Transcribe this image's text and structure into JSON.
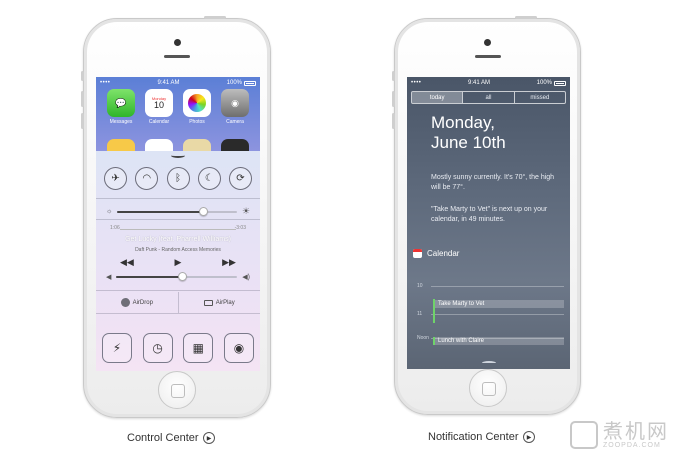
{
  "colors": {
    "page_bg": "#ffffff",
    "phone_body": "#f4f4f4",
    "nc_bg": "#5e6a7c",
    "cc_bg": "#e4e4f4",
    "now_green": "#6fd36a"
  },
  "left_phone": {
    "status": {
      "carrier": "•••• ",
      "time": "9:41 AM",
      "battery": "100%"
    },
    "apps": [
      {
        "label": "Messages",
        "icon": "messages-icon"
      },
      {
        "label": "Calendar",
        "icon": "calendar-icon",
        "day": "10"
      },
      {
        "label": "Photos",
        "icon": "photos-icon"
      },
      {
        "label": "Camera",
        "icon": "camera-icon"
      }
    ],
    "control_center": {
      "toggles": [
        {
          "name": "airplane-mode-toggle",
          "icon": "airplane-icon",
          "glyph": "✈"
        },
        {
          "name": "wifi-toggle",
          "icon": "wifi-icon",
          "glyph": "◠"
        },
        {
          "name": "bluetooth-toggle",
          "icon": "bluetooth-icon",
          "glyph": "ᛒ"
        },
        {
          "name": "do-not-disturb-toggle",
          "icon": "moon-icon",
          "glyph": "☾"
        },
        {
          "name": "rotation-lock-toggle",
          "icon": "rotation-lock-icon",
          "glyph": "⟳"
        }
      ],
      "brightness": 0.72,
      "elapsed": "1:06",
      "remaining": "-3:03",
      "song": "Get Lucky (feat. Pharrell Williams)",
      "artist": "Daft Punk - Random Access Memories",
      "volume": 0.55,
      "airdrop_label": "AirDrop",
      "airplay_label": "AirPlay",
      "quick_actions": [
        {
          "name": "flashlight-button",
          "icon": "flashlight-icon",
          "glyph": "⚡"
        },
        {
          "name": "timer-button",
          "icon": "clock-icon",
          "glyph": "◷"
        },
        {
          "name": "calculator-button",
          "icon": "calculator-icon",
          "glyph": "▦"
        },
        {
          "name": "camera-button",
          "icon": "camera-icon",
          "glyph": "◉"
        }
      ]
    },
    "caption": "Control Center"
  },
  "right_phone": {
    "status": {
      "carrier": "•••• ",
      "time": "9:41 AM",
      "battery": "100%"
    },
    "tabs": [
      {
        "label": "today",
        "active": true
      },
      {
        "label": "all",
        "active": false
      },
      {
        "label": "missed",
        "active": false
      }
    ],
    "date": "Monday,\nJune 10th",
    "weather": "Mostly sunny currently. It's 70°, the high will be 77°.",
    "reminder": "\"Take Marty to Vet\" is next up on your calendar, in 49 minutes.",
    "calendar_title": "Calendar",
    "hours": [
      "10",
      "11",
      "Noon"
    ],
    "events": [
      "Take Marty to Vet",
      "Lunch with Claire"
    ],
    "caption": "Notification Center"
  },
  "watermark": {
    "main": "煮机网",
    "sub": "ZOOPDA.COM"
  }
}
